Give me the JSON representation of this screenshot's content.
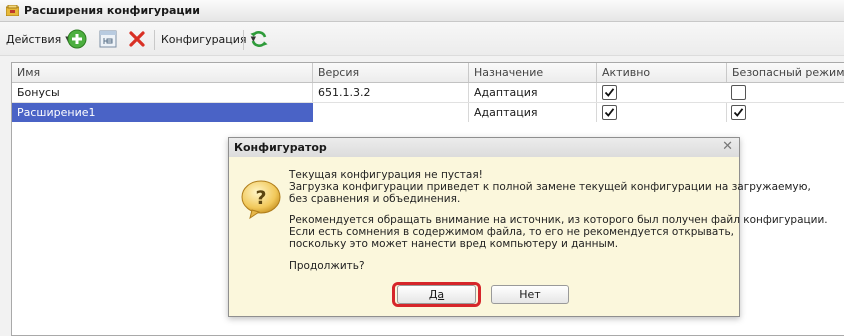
{
  "window": {
    "title": "Расширения конфигурации"
  },
  "toolbar": {
    "actions_label": "Действия",
    "config_label": "Конфигурация",
    "icons": [
      "add-icon",
      "copy-icon",
      "delete-icon",
      "refresh-icon"
    ]
  },
  "table": {
    "columns": [
      "Имя",
      "Версия",
      "Назначение",
      "Активно",
      "Безопасный режим, имя"
    ],
    "rows": [
      {
        "name": "Бонусы",
        "version": "651.1.3.2",
        "purpose": "Адаптация",
        "active": true,
        "safe_mode": false
      },
      {
        "name": "Расширение1",
        "version": "",
        "purpose": "Адаптация",
        "active": true,
        "safe_mode": true
      }
    ],
    "selected_row": 1
  },
  "dialog": {
    "title": "Конфигуратор",
    "close_glyph": "✕",
    "lines": [
      "Текущая конфигурация не пустая!",
      "Загрузка конфигурации приведет к полной замене текущей конфигурации на загружаемую,",
      "без сравнения и объединения.",
      "Рекомендуется обращать внимание на источник, из которого был получен файл конфигурации.",
      "Если есть сомнения в содержимом файла, то его не рекомендуется открывать,",
      "поскольку это может нанести вред компьютеру и данным.",
      "Продолжить?"
    ],
    "yes_label": "Да",
    "no_label": "Нет",
    "highlight_color": "#d6262a"
  },
  "colors": {
    "selection": "#4a63c6",
    "dialog_body": "#fbf7dc"
  }
}
